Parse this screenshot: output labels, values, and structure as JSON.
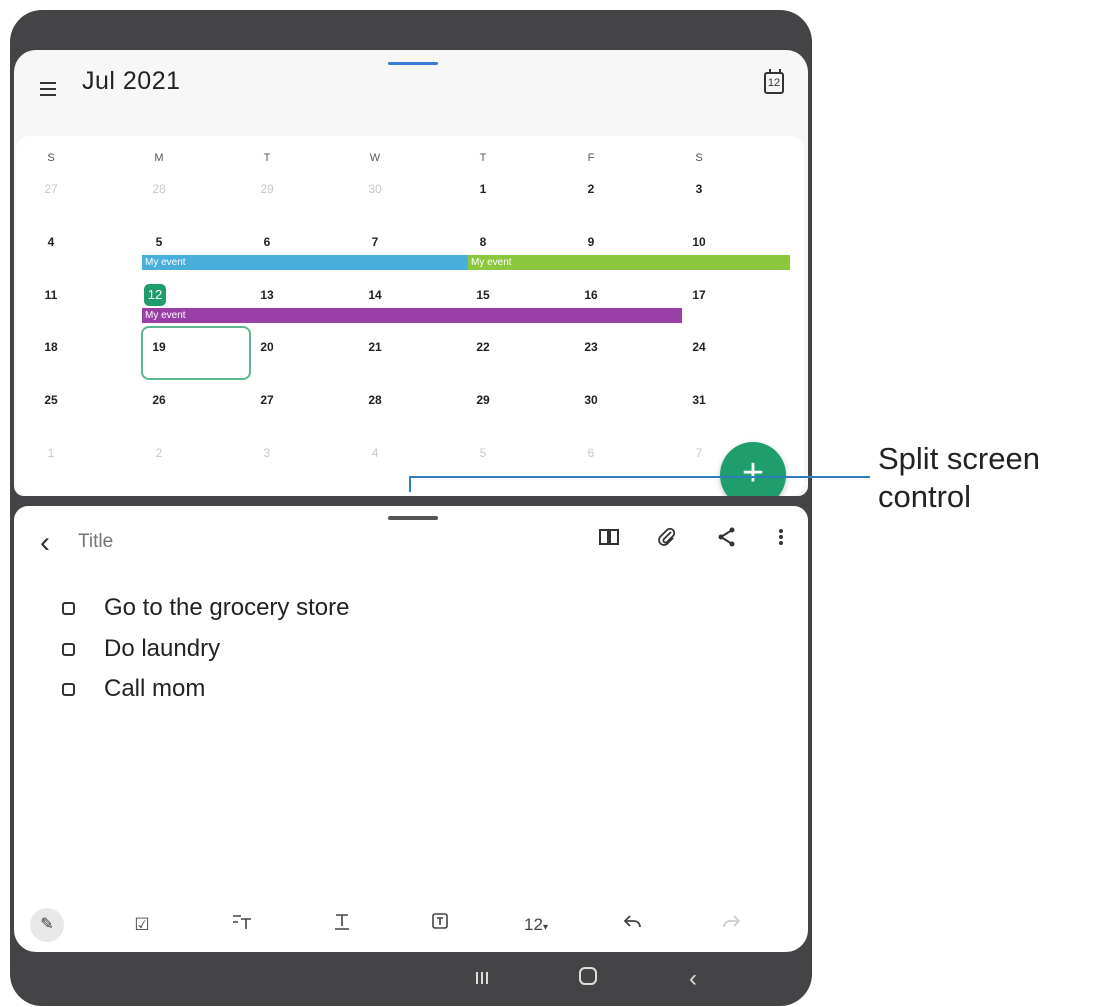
{
  "calendar": {
    "month_title": "Jul 2021",
    "today_icon_day": "12",
    "weekdays": [
      "S",
      "M",
      "T",
      "W",
      "T",
      "F",
      "S"
    ],
    "weeks": [
      [
        "27",
        "28",
        "29",
        "30",
        "1",
        "2",
        "3"
      ],
      [
        "4",
        "5",
        "6",
        "7",
        "8",
        "9",
        "10"
      ],
      [
        "11",
        "12",
        "13",
        "14",
        "15",
        "16",
        "17"
      ],
      [
        "18",
        "19",
        "20",
        "21",
        "22",
        "23",
        "24"
      ],
      [
        "25",
        "26",
        "27",
        "28",
        "29",
        "30",
        "31"
      ],
      [
        "1",
        "2",
        "3",
        "4",
        "5",
        "6",
        "7"
      ]
    ],
    "events": [
      {
        "label": "My event",
        "color": "#4aaedc"
      },
      {
        "label": "My event",
        "color": "#8cc63f"
      },
      {
        "label": "My event",
        "color": "#9b3fa8"
      }
    ],
    "fab_label": "+"
  },
  "notes": {
    "title_placeholder": "Title",
    "checklist": [
      {
        "text": "Go to the grocery store",
        "checked": false
      },
      {
        "text": "Do laundry",
        "checked": false
      },
      {
        "text": "Call mom",
        "checked": false
      }
    ],
    "font_size": "12"
  },
  "callout": {
    "line1": "Split screen",
    "line2": "control"
  },
  "colors": {
    "accent": "#1f9d6c",
    "device_frame": "#444446",
    "callout_line": "#2c7fb8"
  }
}
